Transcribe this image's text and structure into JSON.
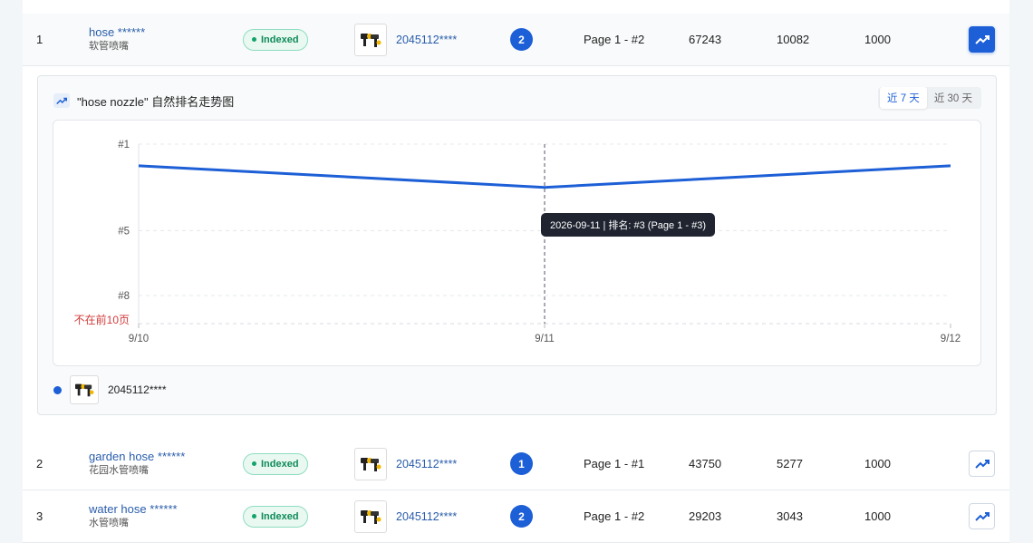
{
  "rows": [
    {
      "index": "1",
      "keyword_en": "hose ******",
      "keyword_cn": "软管喷嘴",
      "status": "Indexed",
      "asin": "2045112****",
      "page_rank": "2",
      "page_label": "Page 1 - #2",
      "metric1": "67243",
      "metric2": "10082",
      "metric3": "1000"
    },
    {
      "index": "2",
      "keyword_en": "garden hose ******",
      "keyword_cn": "花园水管喷嘴",
      "status": "Indexed",
      "asin": "2045112****",
      "page_rank": "1",
      "page_label": "Page 1 - #1",
      "metric1": "43750",
      "metric2": "5277",
      "metric3": "1000"
    },
    {
      "index": "3",
      "keyword_en": "water hose ******",
      "keyword_cn": "水管喷嘴",
      "status": "Indexed",
      "asin": "2045112****",
      "page_rank": "2",
      "page_label": "Page 1 - #2",
      "metric1": "29203",
      "metric2": "3043",
      "metric3": "1000"
    }
  ],
  "panel": {
    "title": "\"hose nozzle\" 自然排名走势图",
    "range_7": "近 7 天",
    "range_30": "近 30 天",
    "legend_label": "2045112****"
  },
  "colors": {
    "accent": "#1d5fd6",
    "indexed_text": "#0f8a5a",
    "not_top_label": "#d43a3a"
  },
  "icons": {
    "trend": "trending-up-icon",
    "thumb": "product-thumbnail"
  },
  "chart_data": {
    "type": "line",
    "title": "\"hose nozzle\" 自然排名走势图",
    "x": [
      "9/10",
      "9/11",
      "9/12"
    ],
    "series": [
      {
        "name": "2045112****",
        "values": [
          2,
          3,
          2
        ]
      }
    ],
    "y_ticks": [
      "#1",
      "#5",
      "#8"
    ],
    "y_bottom_label": "不在前10页",
    "y_range": [
      1,
      9.3
    ],
    "y_inverted": true,
    "grid": true,
    "tooltip": {
      "x": "9/11",
      "text": "2026-09-11 | 排名: #3 (Page 1 - #3)"
    }
  }
}
